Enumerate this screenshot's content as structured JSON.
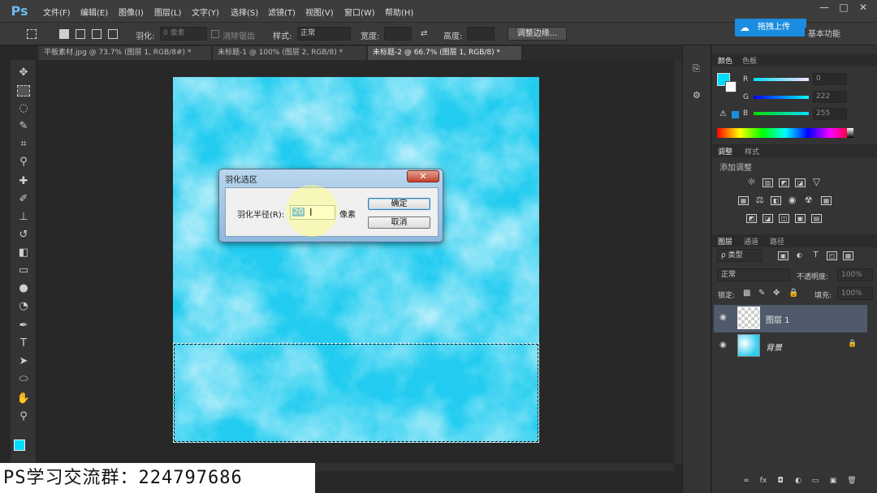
{
  "app": {
    "logo": "Ps"
  },
  "menu": [
    "文件(F)",
    "编辑(E)",
    "图像(I)",
    "图层(L)",
    "文字(Y)",
    "选择(S)",
    "滤镜(T)",
    "视图(V)",
    "窗口(W)",
    "帮助(H)"
  ],
  "window_controls": {
    "minimize": "—",
    "maximize": "□",
    "close": "✕"
  },
  "options": {
    "feather_label": "羽化:",
    "feather_value": "0 像素",
    "antialias_label": "消除锯齿",
    "style_label": "样式:",
    "style_value": "正常",
    "width_label": "宽度:",
    "height_label": "高度:",
    "refine_edge": "调整边缘..."
  },
  "upload": {
    "label": "拖拽上传"
  },
  "workspace_select": "基本功能",
  "tabs": [
    {
      "label": "平板素材.jpg @ 73.7% (图层 1, RGB/8#) *",
      "close": "×"
    },
    {
      "label": "未标题-1 @ 100% (图层 2, RGB/8) *",
      "close": "×"
    },
    {
      "label": "未标题-2 @ 66.7% (图层 1, RGB/8) *",
      "close": "×"
    }
  ],
  "dialog": {
    "title": "羽化选区",
    "close": "✕",
    "radius_label": "羽化半径(R):",
    "radius_value": "20",
    "unit": "像素",
    "ok": "确定",
    "cancel": "取消"
  },
  "watermark": "PS学习交流群：224797686",
  "color_panel": {
    "tabs": [
      "颜色",
      "色板"
    ],
    "channels": [
      {
        "label": "R",
        "value": "0"
      },
      {
        "label": "G",
        "value": "222"
      },
      {
        "label": "B",
        "value": "255"
      }
    ],
    "foreground": "#00deff",
    "warning": "⚠"
  },
  "adjust_panel": {
    "tabs": [
      "调整",
      "样式"
    ],
    "add_label": "添加调整"
  },
  "layers_panel": {
    "tabs": [
      "图层",
      "通道",
      "路径"
    ],
    "kind_label": "ρ 类型",
    "blend_mode": "正常",
    "opacity_label": "不透明度:",
    "opacity_value": "100%",
    "lock_label": "锁定:",
    "fill_label": "填充:",
    "fill_value": "100%",
    "layers": [
      {
        "name": "图层 1"
      },
      {
        "name": "背景"
      }
    ],
    "footer_icons": [
      "∞",
      "fx",
      "◘",
      "◐",
      "▭",
      "▣",
      "🗑"
    ]
  },
  "colors": {
    "accent": "#1b8de0",
    "sky": "#2fcdf0"
  }
}
